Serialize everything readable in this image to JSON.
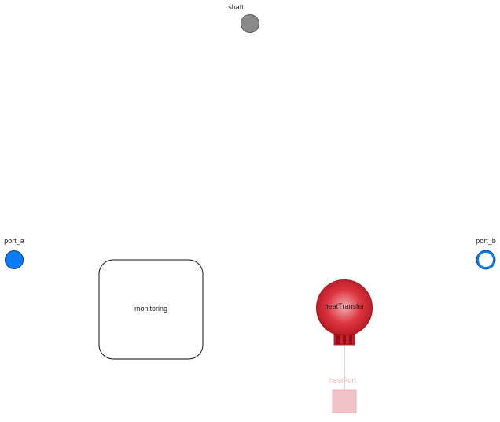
{
  "components": {
    "shaft": {
      "label": "shaft"
    },
    "port_a": {
      "label": "port_a"
    },
    "port_b": {
      "label": "port_b"
    },
    "monitoring": {
      "label": "monitoring"
    },
    "heat_transfer": {
      "label": "heatTransfer"
    },
    "heat_port": {
      "label": "heatPort"
    }
  },
  "colors": {
    "shaft_fill": "#8a8a8a",
    "port_fill": "#0a7cf5",
    "port_b_fill": "#ffffff",
    "heat_transfer_fill": "#d8303b",
    "heat_port_fill": "#f2c3c6"
  }
}
